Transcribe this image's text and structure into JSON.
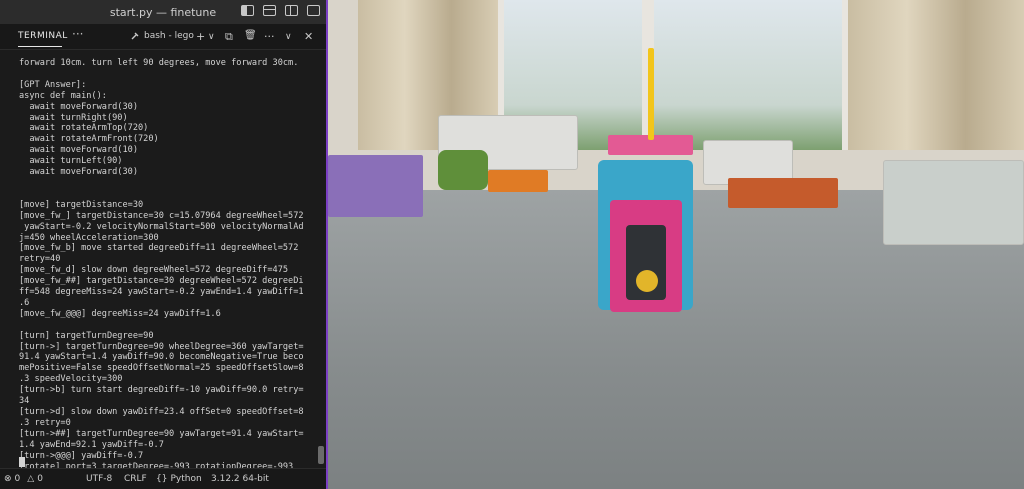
{
  "window": {
    "title": "start.py — finetune",
    "layout_icons": [
      "toggle-sidebar-icon",
      "toggle-panel-icon",
      "toggle-secondary-sidebar-icon",
      "customize-layout-icon"
    ]
  },
  "panel": {
    "active_tab": "TERMINAL",
    "more_label": "···",
    "terminal_name": "bash - lego",
    "add_label": "+",
    "chevron_label": "∨",
    "split_label": "⧉",
    "trash_label": "🗑",
    "more2_label": "···",
    "collapse_label": "∨",
    "close_label": "✕"
  },
  "terminal": {
    "lines": [
      "forward 10cm. turn left 90 degrees, move forward 30cm.",
      "",
      "[GPT Answer]:",
      "async def main():",
      "  await moveForward(30)",
      "  await turnRight(90)",
      "  await rotateArmTop(720)",
      "  await rotateArmFront(720)",
      "  await moveForward(10)",
      "  await turnLeft(90)",
      "  await moveForward(30)",
      "",
      "",
      "[move] targetDistance=30",
      "[move_fw_] targetDistance=30 c=15.07964 degreeWheel=572",
      " yawStart=-0.2 velocityNormalStart=500 velocityNormalAd",
      "j=450 wheelAcceleration=300",
      "[move_fw_b] move started degreeDiff=11 degreeWheel=572",
      "retry=40",
      "[move_fw_d] slow down degreeWheel=572 degreeDiff=475",
      "[move_fw_##] targetDistance=30 degreeWheel=572 degreeDi",
      "ff=548 degreeMiss=24 yawStart=-0.2 yawEnd=1.4 yawDiff=1",
      ".6",
      "[move_fw_@@@] degreeMiss=24 yawDiff=1.6",
      "",
      "[turn] targetTurnDegree=90",
      "[turn->] targetTurnDegree=90 wheelDegree=360 yawTarget=",
      "91.4 yawStart=1.4 yawDiff=90.0 becomeNegative=True beco",
      "mePositive=False speedOffsetNormal=25 speedOffsetSlow=8",
      ".3 speedVelocity=300",
      "[turn->b] turn start degreeDiff=-10 yawDiff=90.0 retry=",
      "34",
      "[turn->d] slow down yawDiff=23.4 offSet=0 speedOffset=8",
      ".3 retry=0",
      "[turn->##] targetTurnDegree=90 yawTarget=91.4 yawStart=",
      "1.4 yawEnd=92.1 yawDiff=-0.7",
      "[turn->@@@] yawDiff=-0.7",
      "[rotate] port=3 targetDegree=-993 rotationDegree=-993"
    ]
  },
  "statusbar": {
    "errors": "0",
    "warnings": "0",
    "encoding": "UTF-8",
    "eol": "CRLF",
    "language": "Python",
    "interpreter": "3.12.2 64-bit"
  }
}
